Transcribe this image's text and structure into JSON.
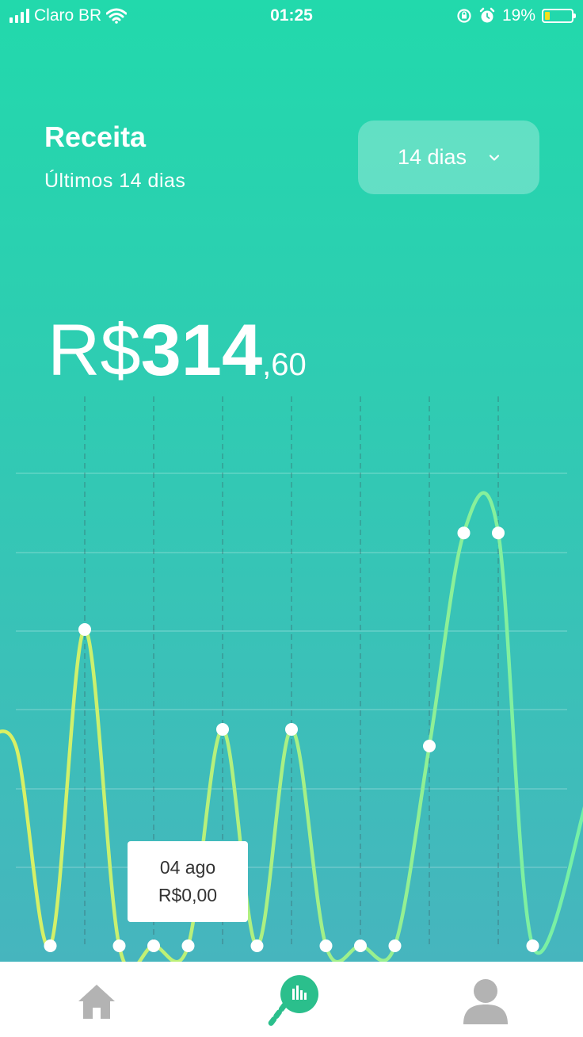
{
  "status_bar": {
    "carrier": "Claro BR",
    "time": "01:25",
    "battery_percent": "19%",
    "battery_level": 0.19,
    "icons": [
      "signal-icon",
      "wifi-icon",
      "rotation-lock-icon",
      "alarm-icon",
      "battery-icon"
    ]
  },
  "header": {
    "title": "Receita",
    "subtitle": "Últimos 14 dias",
    "range_selector": {
      "label": "14 dias",
      "icon": "chevron-down-icon"
    }
  },
  "amount": {
    "currency": "R$",
    "integer": "314",
    "decimal": ",60"
  },
  "tooltip": {
    "date": "04 ago",
    "value": "R$0,00"
  },
  "chart_data": {
    "type": "line",
    "y_relative": [
      0.6,
      0,
      0.95,
      0,
      0,
      0,
      0.65,
      0,
      0.65,
      0,
      0,
      0,
      0.6,
      1.24,
      1.24,
      0
    ],
    "grid": true,
    "colors": {
      "start": "#dff060",
      "end": "#73f0a8"
    }
  },
  "nav": {
    "items": [
      {
        "name": "home",
        "icon": "home-icon",
        "active": false
      },
      {
        "name": "reports",
        "icon": "bar-chart-icon",
        "active": true
      },
      {
        "name": "profile",
        "icon": "user-icon",
        "active": false
      }
    ]
  },
  "colors": {
    "accent": "#22d9ac",
    "active_nav": "#2bbf8c",
    "inactive_nav": "#b3b3b3"
  }
}
